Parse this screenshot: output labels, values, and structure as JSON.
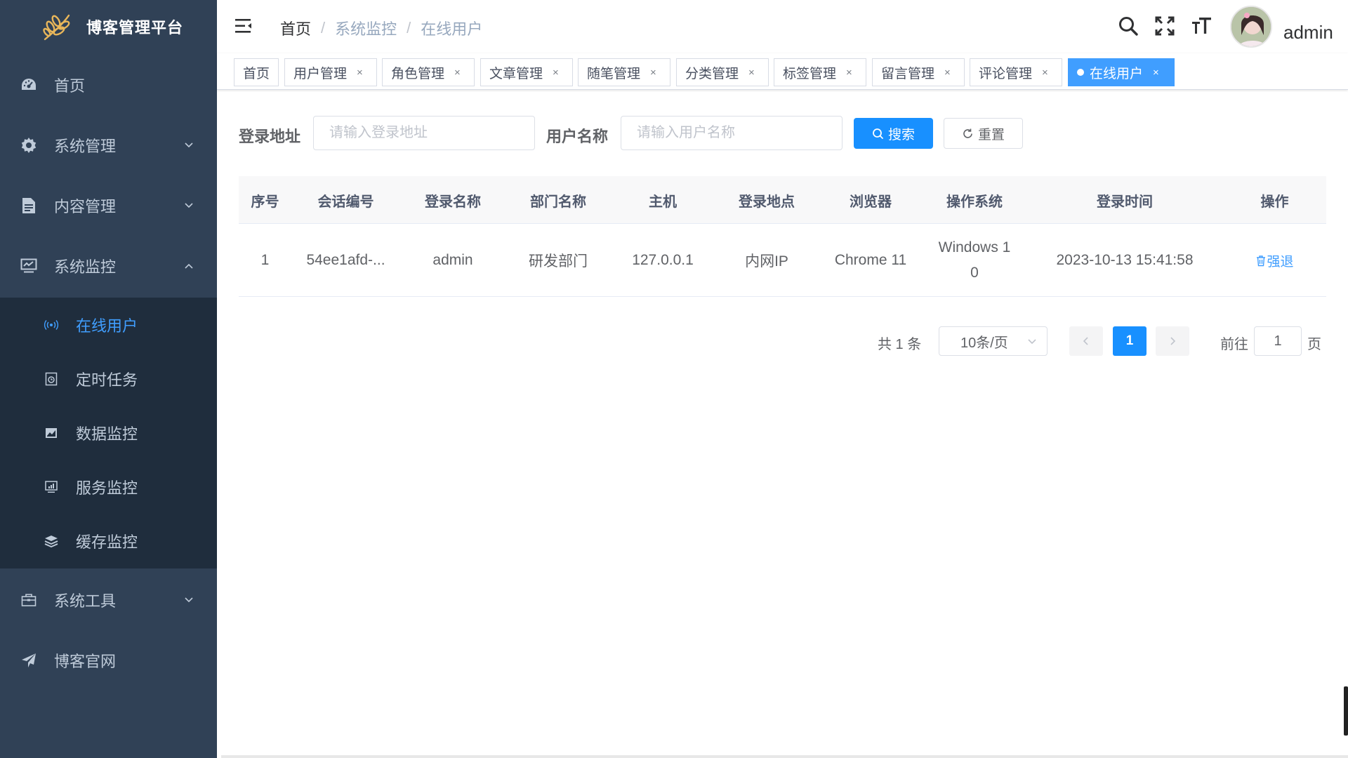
{
  "app": {
    "title": "博客管理平台"
  },
  "sidebar": {
    "items": [
      {
        "label": "首页",
        "icon": "dashboard-icon"
      },
      {
        "label": "系统管理",
        "icon": "gear-icon"
      },
      {
        "label": "内容管理",
        "icon": "document-icon"
      },
      {
        "label": "系统监控",
        "icon": "monitor-icon"
      },
      {
        "label": "系统工具",
        "icon": "toolbox-icon"
      },
      {
        "label": "博客官网",
        "icon": "paper-plane-icon"
      }
    ],
    "monitor_children": [
      {
        "label": "在线用户",
        "icon": "broadcast-icon",
        "active": true
      },
      {
        "label": "定时任务",
        "icon": "timer-icon"
      },
      {
        "label": "数据监控",
        "icon": "image-chart-icon"
      },
      {
        "label": "服务监控",
        "icon": "server-screen-icon"
      },
      {
        "label": "缓存监控",
        "icon": "layers-icon"
      }
    ]
  },
  "navbar": {
    "breadcrumb": [
      "首页",
      "系统监控",
      "在线用户"
    ],
    "username": "admin"
  },
  "tags": [
    {
      "label": "首页",
      "closable": false
    },
    {
      "label": "用户管理",
      "closable": true
    },
    {
      "label": "角色管理",
      "closable": true
    },
    {
      "label": "文章管理",
      "closable": true
    },
    {
      "label": "随笔管理",
      "closable": true
    },
    {
      "label": "分类管理",
      "closable": true
    },
    {
      "label": "标签管理",
      "closable": true
    },
    {
      "label": "留言管理",
      "closable": true
    },
    {
      "label": "评论管理",
      "closable": true
    },
    {
      "label": "在线用户",
      "closable": true,
      "active": true
    }
  ],
  "tag_close_glyph": "×",
  "search": {
    "ipaddr_label": "登录地址",
    "ipaddr_placeholder": "请输入登录地址",
    "ipaddr_value": "",
    "username_label": "用户名称",
    "username_placeholder": "请输入用户名称",
    "username_value": "",
    "search_button": "搜索",
    "reset_button": "重置"
  },
  "table": {
    "columns": [
      "序号",
      "会话编号",
      "登录名称",
      "部门名称",
      "主机",
      "登录地点",
      "浏览器",
      "操作系统",
      "登录时间",
      "操作"
    ],
    "rows": [
      {
        "index": "1",
        "session_id": "54ee1afd-...",
        "login_name": "admin",
        "dept_name": "研发部门",
        "host": "127.0.0.1",
        "location": "内网IP",
        "browser": "Chrome 11",
        "os_line1": "Windows 1",
        "os_line2": "0",
        "login_time": "2023-10-13 15:41:58",
        "action": "强退"
      }
    ]
  },
  "pagination": {
    "total_text": "共 1 条",
    "page_size": "10条/页",
    "current_page": "1",
    "goto_label": "前往",
    "goto_value": "1",
    "page_suffix": "页"
  },
  "colors": {
    "sidebar_bg": "#304156",
    "submenu_bg": "#1f2d3d",
    "accent": "#409eff",
    "primary_button": "#1890ff"
  }
}
